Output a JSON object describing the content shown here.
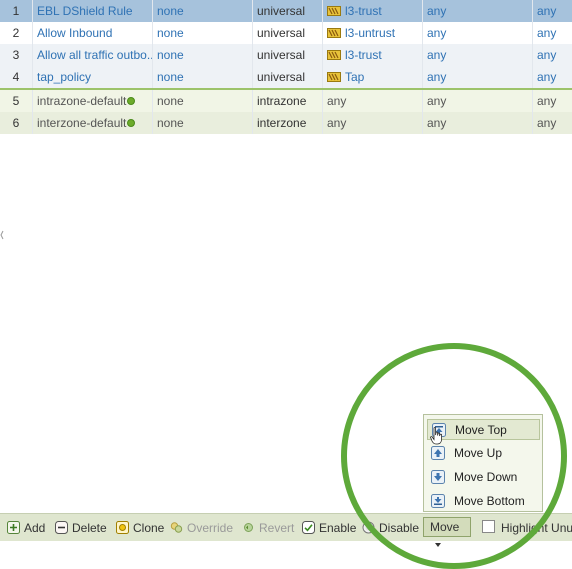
{
  "rules": [
    {
      "num": "1",
      "name": "EBL DShield Rule",
      "tag": "none",
      "type": "universal",
      "zone": "l3-trust",
      "zone_icon": "zone-icon",
      "src_addr": "any",
      "extra": "any",
      "style": "selected"
    },
    {
      "num": "2",
      "name": "Allow Inbound",
      "tag": "none",
      "type": "universal",
      "zone": "l3-untrust",
      "zone_icon": "zone-icon",
      "src_addr": "any",
      "extra": "any",
      "style": "even"
    },
    {
      "num": "3",
      "name": "Allow all traffic outbo...",
      "tag": "none",
      "type": "universal",
      "zone": "l3-trust",
      "zone_icon": "zone-icon",
      "src_addr": "any",
      "extra": "any",
      "style": "even"
    },
    {
      "num": "4",
      "name": "tap_policy",
      "tag": "none",
      "type": "universal",
      "zone": "Tap",
      "zone_icon": "zone-icon",
      "src_addr": "any",
      "extra": "any",
      "style": "odd"
    }
  ],
  "default_rules": [
    {
      "num": "5",
      "name": "intrazone-default",
      "tag": "none",
      "type": "intrazone",
      "zone": "any",
      "src_addr": "any",
      "extra": "any"
    },
    {
      "num": "6",
      "name": "interzone-default",
      "tag": "none",
      "type": "interzone",
      "zone": "any",
      "src_addr": "any",
      "extra": "any"
    }
  ],
  "toolbar": {
    "add": "Add",
    "delete": "Delete",
    "clone": "Clone",
    "override": "Override",
    "revert": "Revert",
    "enable": "Enable",
    "disable": "Disable",
    "move": "Move",
    "highlight": "Highlight Unus"
  },
  "move_menu": {
    "items": [
      {
        "label": "Move Top",
        "icon": "move-top-icon"
      },
      {
        "label": "Move Up",
        "icon": "move-up-icon"
      },
      {
        "label": "Move Down",
        "icon": "move-down-icon"
      },
      {
        "label": "Move Bottom",
        "icon": "move-bottom-icon"
      }
    ]
  },
  "colors": {
    "selected_row": "#a6c2dc",
    "link": "#2f72b4",
    "toolbar_bg": "#dfe6cf",
    "highlight_circle": "#5ea93a"
  }
}
